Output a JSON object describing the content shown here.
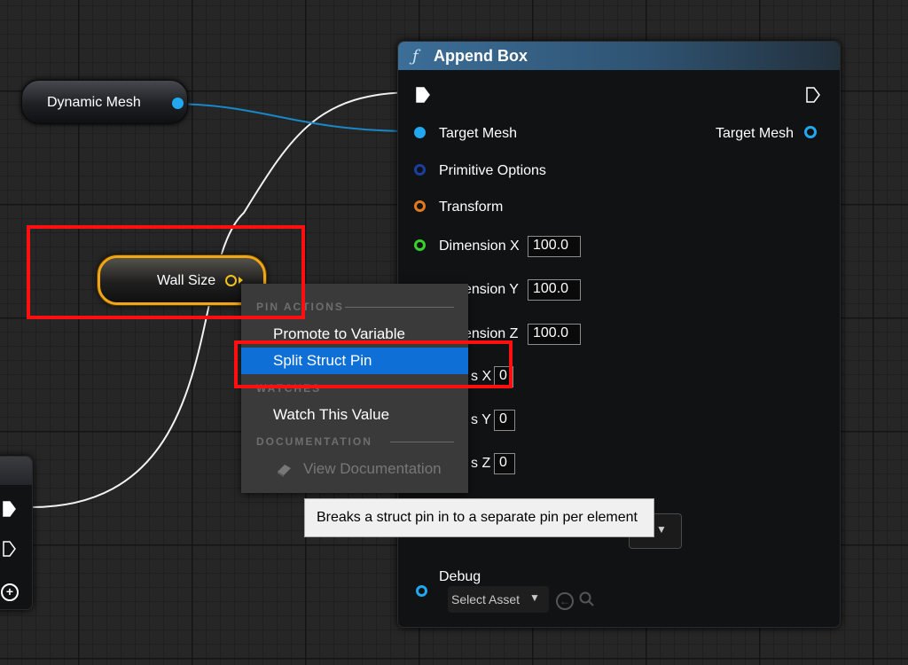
{
  "graph": {
    "dynamic_mesh_node": {
      "label": "Dynamic Mesh"
    },
    "wall_size_node": {
      "label": "Wall Size"
    },
    "append_box_node": {
      "title": "Append Box",
      "inputs": {
        "target_mesh": "Target Mesh",
        "primitive_options": "Primitive Options",
        "transform": "Transform",
        "dimension_x_label": "Dimension X",
        "dimension_x_value": "100.0",
        "dimension_y_label": "ension Y",
        "dimension_y_value": "100.0",
        "dimension_z_label": "ension Z",
        "dimension_z_value": "100.0",
        "steps_x_label": "s X",
        "steps_x_value": "0",
        "steps_y_label": "s Y",
        "steps_y_value": "0",
        "steps_z_label": "s Z",
        "steps_z_value": "0"
      },
      "outputs": {
        "target_mesh": "Target Mesh"
      },
      "debug": {
        "label": "Debug",
        "select_asset": "Select Asset"
      }
    }
  },
  "context_menu": {
    "sections": [
      {
        "header": "PIN ACTIONS"
      },
      {
        "header": "WATCHES"
      },
      {
        "header": "DOCUMENTATION"
      }
    ],
    "items": {
      "promote": "Promote to Variable",
      "split": "Split Struct Pin",
      "watch": "Watch This Value",
      "view_doc": "View Documentation"
    }
  },
  "tooltip": {
    "text": "Breaks a struct pin in to a separate pin per element"
  },
  "colors": {
    "object_pin": "#22a8ef",
    "struct_pin": "#1a3fa0",
    "transform_pin": "#e07a1a",
    "float_pin": "#3bd12d",
    "vector_pin": "#f1c21b",
    "highlight": "#0e70d6",
    "annotation": "#ff0f0f"
  },
  "icons": {
    "function": "function-icon",
    "exec": "exec-pin-icon",
    "document": "document-icon",
    "browse": "search-icon",
    "use_selected": "use-selected-arrow-icon",
    "add": "add-pin-icon"
  }
}
